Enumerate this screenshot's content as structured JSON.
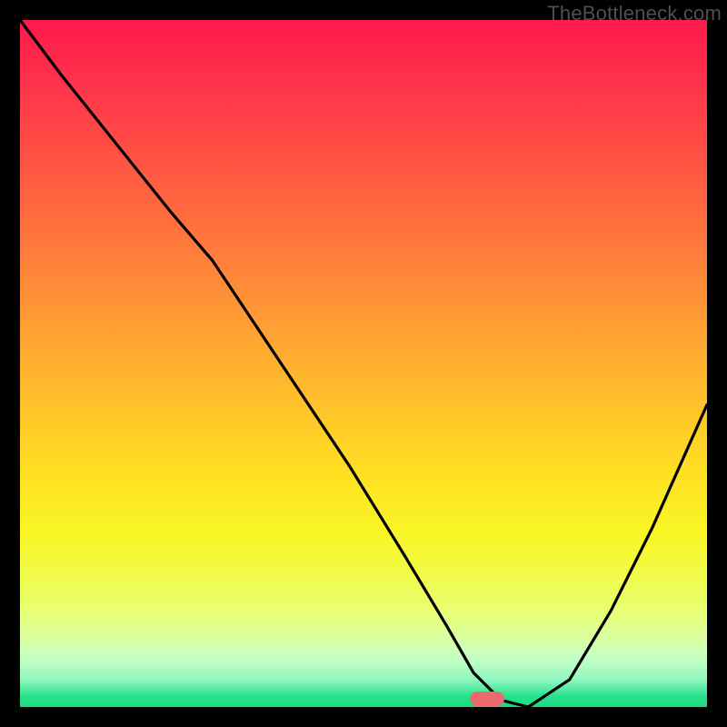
{
  "watermark": "TheBottleneck.com",
  "colors": {
    "frame": "#000000",
    "gradient_top": "#ff1a4b",
    "gradient_bottom": "#1bd981",
    "curve": "#000000",
    "marker": "#e96a6f"
  },
  "chart_data": {
    "type": "line",
    "title": "",
    "xlabel": "",
    "ylabel": "",
    "xlim": [
      0,
      100
    ],
    "ylim": [
      0,
      100
    ],
    "series": [
      {
        "name": "curve",
        "x": [
          0,
          6,
          14,
          22,
          28,
          38,
          48,
          56,
          62,
          66,
          70,
          74,
          80,
          86,
          92,
          100
        ],
        "y": [
          100,
          92,
          82,
          72,
          65,
          50,
          35,
          22,
          12,
          5,
          1,
          0,
          4,
          14,
          26,
          44
        ]
      }
    ],
    "annotations": [
      {
        "name": "optimum-marker",
        "x": 68,
        "y": 1.2,
        "shape": "rounded-rect",
        "color": "#e96a6f"
      }
    ]
  }
}
